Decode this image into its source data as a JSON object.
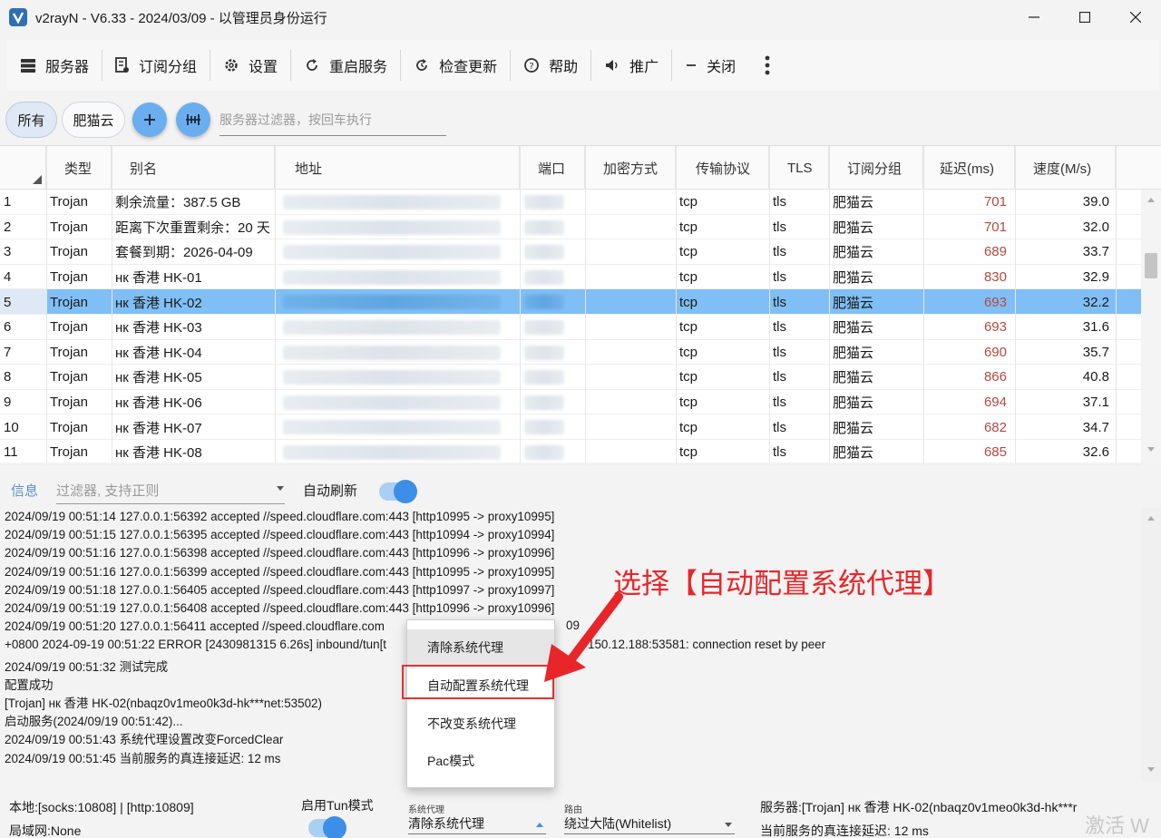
{
  "window": {
    "title": "v2rayN - V6.33 - 2024/03/09 - 以管理员身份运行",
    "minimize_glyph": "—",
    "maximize_glyph": "☐",
    "close_glyph": "✕"
  },
  "toolbar": {
    "servers": "服务器",
    "subscription": "订阅分组",
    "settings": "设置",
    "restart": "重启服务",
    "check_update": "检查更新",
    "help": "帮助",
    "promote": "推广",
    "close": "关闭"
  },
  "filters": {
    "all": "所有",
    "group": "肥猫云",
    "server_filter_placeholder": "服务器过滤器，按回车执行"
  },
  "table": {
    "headers": [
      "类型",
      "别名",
      "地址",
      "端口",
      "加密方式",
      "传输协议",
      "TLS",
      "订阅分组",
      "延迟(ms)",
      "速度(M/s)"
    ],
    "selected_index": 4,
    "rows": [
      {
        "no": "1",
        "type": "Trojan",
        "alias": "剩余流量：387.5 GB",
        "network": "tcp",
        "tls": "tls",
        "group": "肥猫云",
        "latency": "701",
        "speed": "39.0"
      },
      {
        "no": "2",
        "type": "Trojan",
        "alias": "距离下次重置剩余：20 天",
        "network": "tcp",
        "tls": "tls",
        "group": "肥猫云",
        "latency": "701",
        "speed": "32.0"
      },
      {
        "no": "3",
        "type": "Trojan",
        "alias": "套餐到期：2026-04-09",
        "network": "tcp",
        "tls": "tls",
        "group": "肥猫云",
        "latency": "689",
        "speed": "33.7"
      },
      {
        "no": "4",
        "type": "Trojan",
        "alias": "нк 香港 HK-01",
        "network": "tcp",
        "tls": "tls",
        "group": "肥猫云",
        "latency": "830",
        "speed": "32.9"
      },
      {
        "no": "5",
        "type": "Trojan",
        "alias": "нк 香港 HK-02",
        "network": "tcp",
        "tls": "tls",
        "group": "肥猫云",
        "latency": "693",
        "speed": "32.2"
      },
      {
        "no": "6",
        "type": "Trojan",
        "alias": "нк 香港 HK-03",
        "network": "tcp",
        "tls": "tls",
        "group": "肥猫云",
        "latency": "693",
        "speed": "31.6"
      },
      {
        "no": "7",
        "type": "Trojan",
        "alias": "нк 香港 HK-04",
        "network": "tcp",
        "tls": "tls",
        "group": "肥猫云",
        "latency": "690",
        "speed": "35.7"
      },
      {
        "no": "8",
        "type": "Trojan",
        "alias": "нк 香港 HK-05",
        "network": "tcp",
        "tls": "tls",
        "group": "肥猫云",
        "latency": "866",
        "speed": "40.8"
      },
      {
        "no": "9",
        "type": "Trojan",
        "alias": "нк 香港 HK-06",
        "network": "tcp",
        "tls": "tls",
        "group": "肥猫云",
        "latency": "694",
        "speed": "37.1"
      },
      {
        "no": "10",
        "type": "Trojan",
        "alias": "нк 香港 HK-07",
        "network": "tcp",
        "tls": "tls",
        "group": "肥猫云",
        "latency": "682",
        "speed": "34.7"
      },
      {
        "no": "11",
        "type": "Trojan",
        "alias": "нк 香港 HK-08",
        "network": "tcp",
        "tls": "tls",
        "group": "肥猫云",
        "latency": "685",
        "speed": "32.6"
      }
    ]
  },
  "log": {
    "tab": "信息",
    "filter_placeholder": "过滤器, 支持正则",
    "auto_refresh": "自动刷新",
    "lines": [
      "2024/09/19 00:51:14 127.0.0.1:56392 accepted //speed.cloudflare.com:443 [http10995 -> proxy10995]",
      "2024/09/19 00:51:15 127.0.0.1:56395 accepted //speed.cloudflare.com:443 [http10994 -> proxy10994]",
      "2024/09/19 00:51:16 127.0.0.1:56398 accepted //speed.cloudflare.com:443 [http10996 -> proxy10996]",
      "2024/09/19 00:51:16 127.0.0.1:56399 accepted //speed.cloudflare.com:443 [http10995 -> proxy10995]",
      "2024/09/19 00:51:18 127.0.0.1:56405 accepted //speed.cloudflare.com:443 [http10997 -> proxy10997]",
      "2024/09/19 00:51:19 127.0.0.1:56408 accepted //speed.cloudflare.com:443 [http10996 -> proxy10996]",
      "2024/09/19 00:51:20 127.0.0.1:56411 accepted //speed.cloudflare.com",
      "+0800 2024-09-19 00:51:22 ERROR [2430981315 6.26s] inbound/tun[t",
      "2024/09/19 00:51:32 测试完成",
      "配置成功",
      "[Trojan] нк 香港 HK-02(nbaqz0v1meo0k3d-hk***net:53502)",
      "启动服务(2024/09/19 00:51:42)...",
      "2024/09/19 00:51:43 系统代理设置改变ForcedClear",
      "2024/09/19 00:51:45 当前服务的真连接延迟: 12 ms"
    ],
    "line6_tail": "09",
    "line7_tail": "150.12.188:53581: connection reset by peer"
  },
  "context_menu": {
    "items": [
      "清除系统代理",
      "自动配置系统代理",
      "不改变系统代理",
      "Pac模式"
    ]
  },
  "annotation": "选择【自动配置系统代理】",
  "status": {
    "local": "本地:[socks:10808] | [http:10809]",
    "lan": "局域网:None",
    "tun_label": "启用Tun模式",
    "sysproxy_caption": "系统代理",
    "sysproxy_value": "清除系统代理",
    "routing_caption": "路由",
    "routing_value": "绕过大陆(Whitelist)",
    "server": "服务器:[Trojan] нк 香港 HK-02(nbaqz0v1meo0k3d-hk***r",
    "latency": "当前服务的真连接延迟: 12 ms",
    "watermark": "激活 W"
  },
  "colors": {
    "selection": "#80bff5",
    "accent": "#3d8ee8",
    "latency_text": "#b4493f",
    "annotation": "#e8262a"
  }
}
